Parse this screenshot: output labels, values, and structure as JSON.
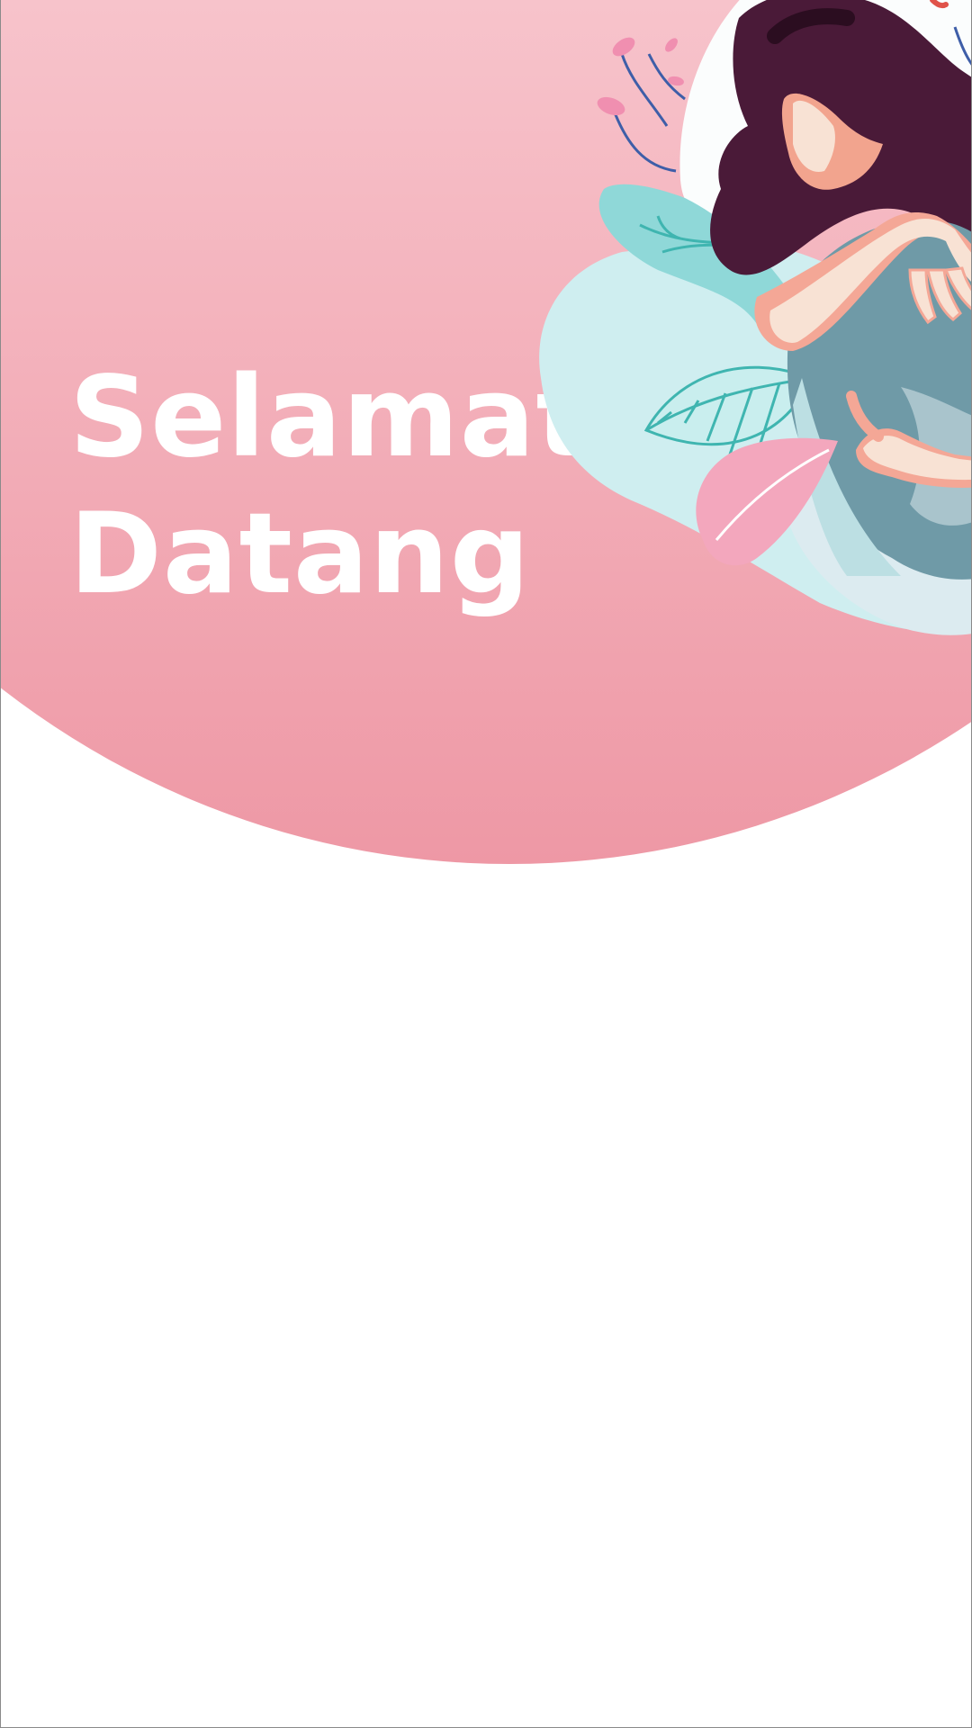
{
  "welcome": {
    "line1": "Selamat",
    "line2": "Datang"
  },
  "illustration": {
    "icon": "woman-hugging-knees-illustration"
  },
  "colors": {
    "hero_top": "#f7c3cb",
    "hero_bottom": "#ee98a5",
    "title_text": "#ffffff",
    "hair": "#4a1a38",
    "skin": "#f8e2d4",
    "clothing": "#6f9aa7",
    "leaf_teal": "#8fd8d8",
    "leaf_pink": "#f3a7bd"
  }
}
